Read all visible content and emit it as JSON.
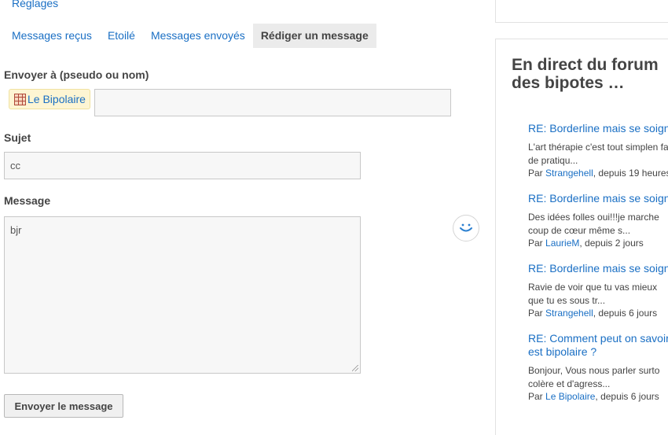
{
  "top_link": "Réglages",
  "tabs": [
    {
      "label": "Messages reçus"
    },
    {
      "label": "Etoilé"
    },
    {
      "label": "Messages envoyés"
    },
    {
      "label": "Rédiger un message",
      "active": true
    }
  ],
  "form": {
    "recipient_label": "Envoyer à (pseudo ou nom)",
    "recipient_chip": "Le Bipolaire",
    "recipient_input_value": "",
    "subject_label": "Sujet",
    "subject_value": "cc",
    "message_label": "Message",
    "message_value": "bjr",
    "send_label": "Envoyer le message"
  },
  "sidebar": {
    "title": "En direct du forum des bipotes …",
    "items": [
      {
        "title": "RE: Borderline mais se soign",
        "excerpt": "L'art thérapie c'est tout simplen fait de pratiqu...",
        "by": "Par",
        "author": "Strangehell",
        "when": ", depuis 19 heures"
      },
      {
        "title": "RE: Borderline mais se soign",
        "excerpt": "Des idées folles oui!!!je marche coup de cœur même s...",
        "by": "Par",
        "author": "LaurieM",
        "when": ", depuis 2 jours"
      },
      {
        "title": "RE: Borderline mais se soign",
        "excerpt": "Ravie de voir que tu vas mieux que tu es sous tr...",
        "by": "Par",
        "author": "Strangehell",
        "when": ", depuis 6 jours"
      },
      {
        "title": "RE: Comment peut on savoir est bipolaire ?",
        "excerpt": "Bonjour, Vous nous parler surto colère et d'agress...",
        "by": "Par",
        "author": "Le Bipolaire",
        "when": ", depuis 6 jours"
      }
    ]
  },
  "colors": {
    "link": "#1a6fc4",
    "active_tab_bg": "#ebebeb",
    "chip_bg": "#fdf5d3"
  },
  "icons": {
    "smiley": "smiley-icon",
    "avatar": "user-avatar-icon"
  }
}
